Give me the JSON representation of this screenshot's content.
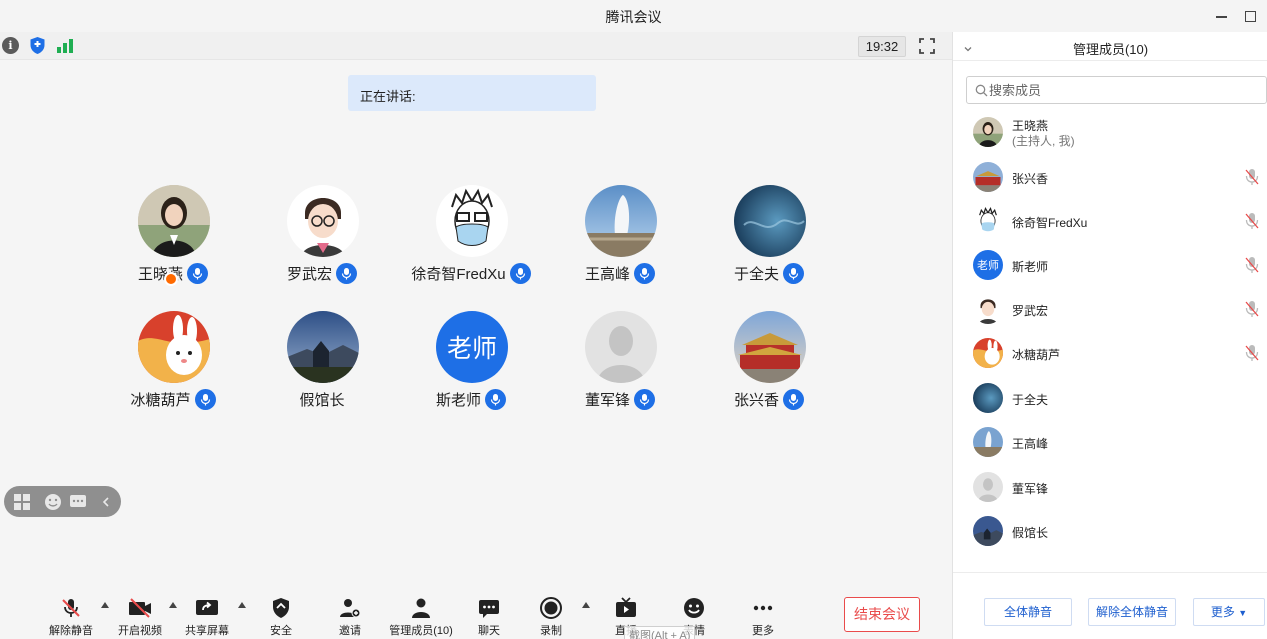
{
  "window": {
    "title": "腾讯会议"
  },
  "stage": {
    "clock": "19:32",
    "speaking_label": "正在讲话:",
    "participants": [
      {
        "name": "王晓燕",
        "avatar": "photo-woman",
        "host": true,
        "mic": true
      },
      {
        "name": "罗武宏",
        "avatar": "cartoon-man-glasses",
        "mic": true
      },
      {
        "name": "徐奇智FredXu",
        "avatar": "sketch-man-mask",
        "mic": true
      },
      {
        "name": "王高峰",
        "avatar": "photo-geyser",
        "mic": true
      },
      {
        "name": "于全夫",
        "avatar": "photo-ocean",
        "mic": true
      },
      {
        "name": "冰糖葫芦",
        "avatar": "cartoon-rabbit",
        "mic": true
      },
      {
        "name": "假馆长",
        "avatar": "photo-church",
        "mic": false
      },
      {
        "name": "斯老师",
        "avatar": "text",
        "avatar_text": "老师",
        "mic": true
      },
      {
        "name": "董军锋",
        "avatar": "default-person",
        "mic": true
      },
      {
        "name": "张兴香",
        "avatar": "photo-tiananmen",
        "mic": true
      }
    ]
  },
  "toolbar": {
    "unmute": "解除静音",
    "video": "开启视频",
    "share": "共享屏幕",
    "security": "安全",
    "invite": "邀请",
    "members": "管理成员(10)",
    "chat": "聊天",
    "record": "录制",
    "live": "直播",
    "emoji": "表情",
    "more": "更多",
    "end": "结束会议",
    "tooltip": "截图(Alt + A)"
  },
  "panel": {
    "title": "管理成员(10)",
    "search_placeholder": "搜索成员",
    "members": [
      {
        "name": "王晓燕",
        "sub": "(主持人, 我)",
        "avatar": "photo-woman",
        "muted_icon": false
      },
      {
        "name": "张兴香",
        "avatar": "photo-tiananmen",
        "muted_icon": true
      },
      {
        "name": "徐奇智FredXu",
        "avatar": "sketch-man-mask",
        "muted_icon": true
      },
      {
        "name": "斯老师",
        "avatar": "text",
        "avatar_text": "老师",
        "muted_icon": true
      },
      {
        "name": "罗武宏",
        "avatar": "cartoon-man-glasses",
        "muted_icon": true
      },
      {
        "name": "冰糖葫芦",
        "avatar": "cartoon-rabbit",
        "muted_icon": true
      },
      {
        "name": "于全夫",
        "avatar": "photo-ocean",
        "muted_icon": false
      },
      {
        "name": "王高峰",
        "avatar": "photo-geyser",
        "muted_icon": false
      },
      {
        "name": "董军锋",
        "avatar": "default-person",
        "muted_icon": false
      },
      {
        "name": "假馆长",
        "avatar": "photo-church",
        "muted_icon": false
      }
    ],
    "mute_all": "全体静音",
    "unmute_all": "解除全体静音",
    "more": "更多"
  },
  "colors": {
    "accent": "#1e6fe6",
    "end": "#e94b4b",
    "host_badge": "#ff6a00"
  }
}
